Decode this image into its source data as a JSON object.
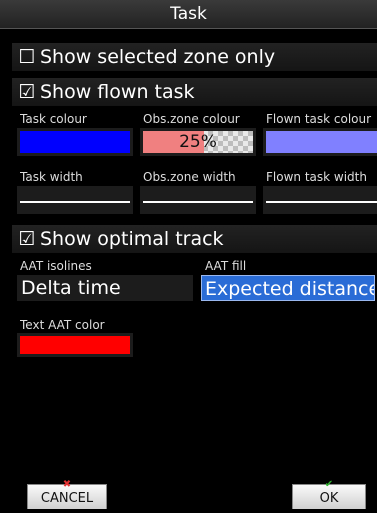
{
  "window": {
    "title": "Task"
  },
  "options": {
    "show_selected_zone_only": {
      "label": "Show selected zone only",
      "checked": false,
      "checkbox": "☐"
    },
    "show_flown_task": {
      "label": "Show flown task",
      "checked": true,
      "checkbox": "☑"
    },
    "show_optimal_track": {
      "label": "Show optimal track",
      "checked": true,
      "checkbox": "☑"
    }
  },
  "colours": {
    "task_colour": {
      "label": "Task colour",
      "color": "#0000ff"
    },
    "obs_zone_colour": {
      "label": "Obs.zone colour",
      "color": "#f08080",
      "opacity": "25%"
    },
    "flown_task_colour": {
      "label": "Flown task colour",
      "color": "#8080ff"
    }
  },
  "widths": {
    "task_width": {
      "label": "Task width"
    },
    "obs_zone_width": {
      "label": "Obs.zone width"
    },
    "flown_task_width": {
      "label": "Flown task width"
    }
  },
  "aat": {
    "isolines": {
      "label": "AAT isolines",
      "value": "Delta time"
    },
    "fill": {
      "label": "AAT fill",
      "value": "Expected distance"
    },
    "text_color": {
      "label": "Text AAT color",
      "color": "#ff0000"
    }
  },
  "buttons": {
    "cancel": {
      "label": "CANCEL",
      "icon": "cancel-x-icon",
      "color": "#e03030"
    },
    "ok": {
      "label": "OK",
      "icon": "ok-check-icon",
      "color": "#30b030"
    }
  },
  "theme": {
    "selection": "#2a6cd6"
  }
}
